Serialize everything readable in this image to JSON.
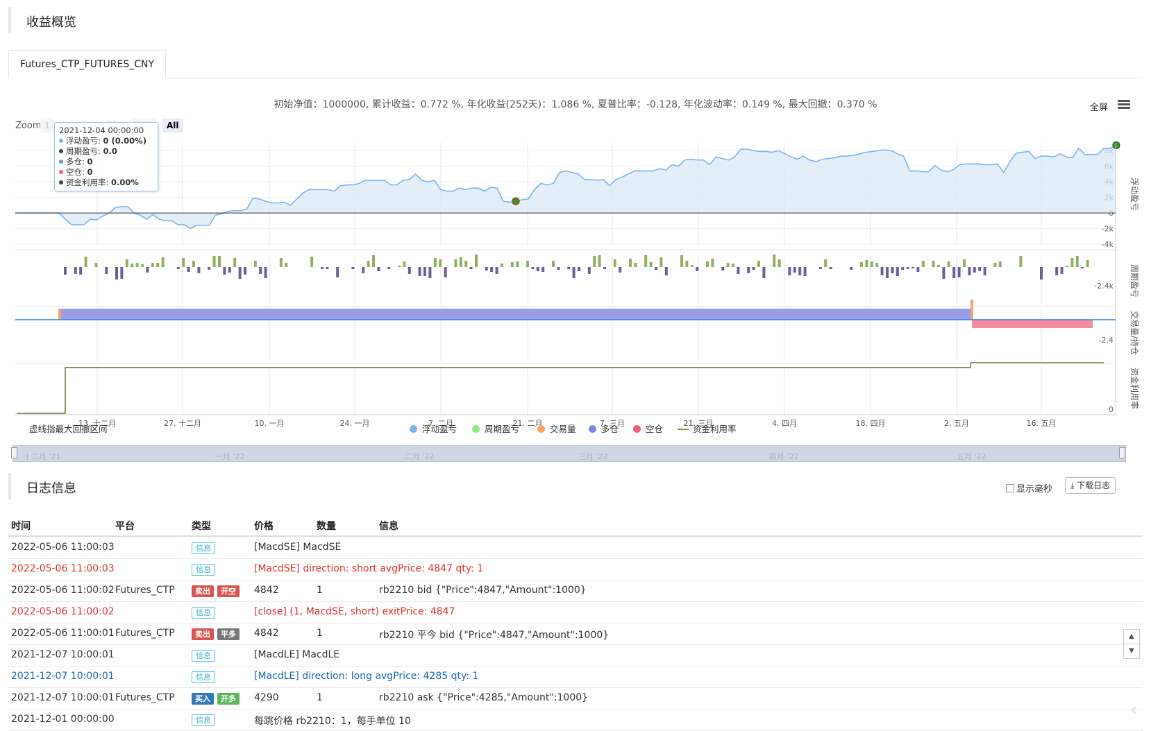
{
  "overview": {
    "title": "收益概览"
  },
  "tabs": [
    {
      "label": "Futures_CTP_FUTURES_CNY"
    }
  ],
  "stats_text": "初始净值：1000000, 累计收益：0.772 %, 年化收益(252天)：1.086 %, 夏普比率：-0.128, 年化波动率：0.149 %, 最大回撤：0.370 %",
  "toolbar": {
    "fullscreen": "全屏",
    "menu_icon": "hamburger-icon"
  },
  "zoom": {
    "label": "Zoom",
    "buttons": [
      "1",
      "24h",
      "All"
    ],
    "active": "All"
  },
  "tooltip": {
    "date": "2021-12-04 00:00:00",
    "rows": [
      {
        "name": "浮动盈亏",
        "value": "0 (0.00%)",
        "color": "#7cb5ec"
      },
      {
        "name": "周期盈亏",
        "value": "0.0",
        "color": "#434348"
      },
      {
        "name": "多仓",
        "value": "0",
        "color": "#8085e9"
      },
      {
        "name": "空仓",
        "value": "0",
        "color": "#f15c80"
      },
      {
        "name": "资金利用率",
        "value": "0.00%",
        "color": "#434348"
      }
    ]
  },
  "drawdown_label": "虚线指最大回撤区间",
  "chart_data": {
    "type": "line",
    "x_ticks": [
      "13. 十二月",
      "27. 十二月",
      "10. 一月",
      "24. 一月",
      "7. 二月",
      "21. 二月",
      "7. 三月",
      "21. 三月",
      "4. 四月",
      "18. 四月",
      "2. 五月",
      "16. 五月"
    ],
    "panels": [
      {
        "name": "浮动盈亏",
        "y_ticks": [
          "8k",
          "6k",
          "4k",
          "2k",
          "0",
          "-2k",
          "-4k"
        ],
        "ylim": [
          -4000,
          9000
        ],
        "color": "#7cb5ec",
        "values": [
          0,
          0,
          0,
          0,
          0,
          0,
          0,
          0,
          -800,
          -1500,
          -1500,
          -1500,
          -800,
          -900,
          -400,
          0,
          700,
          800,
          800,
          0,
          -300,
          -800,
          -200,
          -800,
          -1000,
          -1000,
          -1500,
          -1500,
          -2000,
          -1600,
          -1600,
          -1600,
          -300,
          -100,
          200,
          300,
          300,
          500,
          1900,
          1800,
          1500,
          1300,
          1300,
          1400,
          1000,
          1800,
          2600,
          3000,
          3000,
          3000,
          3000,
          2800,
          3500,
          3600,
          3600,
          3800,
          4200,
          4200,
          4200,
          4200,
          3600,
          3600,
          4200,
          4300,
          5000,
          4200,
          4000,
          4200,
          3000,
          2800,
          2800,
          3200,
          3000,
          3200,
          3200,
          2800,
          3300,
          3200,
          1500,
          1400,
          1500,
          1700,
          1800,
          3000,
          3800,
          3600,
          3800,
          5200,
          5400,
          5200,
          5000,
          4300,
          4300,
          4200,
          4300,
          3500,
          4300,
          4600,
          5000,
          5400,
          5400,
          5400,
          5400,
          5700,
          5500,
          6200,
          6000,
          6800,
          6900,
          6800,
          6800,
          6200,
          7200,
          7000,
          6800,
          7200,
          8200,
          8200,
          8000,
          7900,
          7900,
          7800,
          8000,
          7600,
          7200,
          6900,
          7300,
          6800,
          6600,
          6900,
          7000,
          7100,
          7300,
          7300,
          7400,
          7600,
          7800,
          7900,
          8000,
          8100,
          8000,
          7600,
          7300,
          5400,
          5400,
          5300,
          5300,
          6100,
          5500,
          5300,
          5600,
          6200,
          6300,
          6300,
          6300,
          6200,
          6200,
          6300,
          5200,
          6600,
          7700,
          7800,
          7900,
          7000,
          7300,
          7300,
          7200,
          7600,
          7200,
          7100,
          8300,
          7500,
          7500,
          7500,
          8300,
          8300,
          8700
        ]
      },
      {
        "name": "周期盈亏",
        "y_ticks": [
          "-2.4k"
        ],
        "color_pos": "#90b060",
        "color_neg": "#6e5f9c"
      },
      {
        "name": "交易量/持仓",
        "y_ticks": [
          "-2.4"
        ],
        "long_color": "#9a9ce8",
        "short_color": "#f48aa0",
        "trade_color": "#f3a46a"
      },
      {
        "name": "资金利用率",
        "y_ticks": [
          "0"
        ],
        "color": "#6e6b2b"
      }
    ],
    "legend": [
      {
        "name": "浮动盈亏",
        "color": "#7cb5ec"
      },
      {
        "name": "周期盈亏",
        "color": "#90ed7d"
      },
      {
        "name": "交易量",
        "color": "#f7a35c"
      },
      {
        "name": "多仓",
        "color": "#8085e9"
      },
      {
        "name": "空仓",
        "color": "#f15c80"
      },
      {
        "name": "资金利用率",
        "color": "#8f8a3a"
      }
    ],
    "navigator_labels": [
      "十二月 '21",
      "一月 '22",
      "二月 '22",
      "三月 '22",
      "四月 '22",
      "五月 '22"
    ]
  },
  "log": {
    "title": "日志信息",
    "show_ms": "显示毫秒",
    "download": "下载日志",
    "columns": [
      "时间",
      "平台",
      "类型",
      "价格",
      "数量",
      "信息"
    ],
    "rows": [
      {
        "time": "2022-05-06 11:00:03",
        "platform": "",
        "type": "信息",
        "type2": "",
        "price": "[MacdSE] MacdSE",
        "qty": "",
        "info": "",
        "style": ""
      },
      {
        "time": "2022-05-06 11:00:03",
        "platform": "",
        "type": "信息",
        "type2": "",
        "price": "[MacdSE] direction: short avgPrice: 4847 qty: 1",
        "qty": "",
        "info": "",
        "style": "red"
      },
      {
        "time": "2022-05-06 11:00:02",
        "platform": "Futures_CTP",
        "type": "卖出",
        "type2": "开空",
        "price": "4842",
        "qty": "1",
        "info": "rb2210 bid {\"Price\":4847,\"Amount\":1000}",
        "style": ""
      },
      {
        "time": "2022-05-06 11:00:02",
        "platform": "",
        "type": "信息",
        "type2": "",
        "price": "[close] (1, MacdSE, short) exitPrice: 4847",
        "qty": "",
        "info": "",
        "style": "red"
      },
      {
        "time": "2022-05-06 11:00:01",
        "platform": "Futures_CTP",
        "type": "卖出",
        "type2": "平多",
        "price": "4842",
        "qty": "1",
        "info": "rb2210 平今 bid {\"Price\":4847,\"Amount\":1000}",
        "style": ""
      },
      {
        "time": "2021-12-07 10:00:01",
        "platform": "",
        "type": "信息",
        "type2": "",
        "price": "[MacdLE] MacdLE",
        "qty": "",
        "info": "",
        "style": ""
      },
      {
        "time": "2021-12-07 10:00:01",
        "platform": "",
        "type": "信息",
        "type2": "",
        "price": "[MacdLE] direction: long avgPrice: 4285 qty: 1",
        "qty": "",
        "info": "",
        "style": "blue"
      },
      {
        "time": "2021-12-07 10:00:01",
        "platform": "Futures_CTP",
        "type": "买入",
        "type2": "开多",
        "price": "4290",
        "qty": "1",
        "info": "rb2210 ask {\"Price\":4285,\"Amount\":1000}",
        "style": ""
      },
      {
        "time": "2021-12-01 00:00:00",
        "platform": "",
        "type": "信息",
        "type2": "",
        "price": "每跳价格 rb2210：1，每手单位 10",
        "qty": "",
        "info": "",
        "style": ""
      }
    ]
  }
}
